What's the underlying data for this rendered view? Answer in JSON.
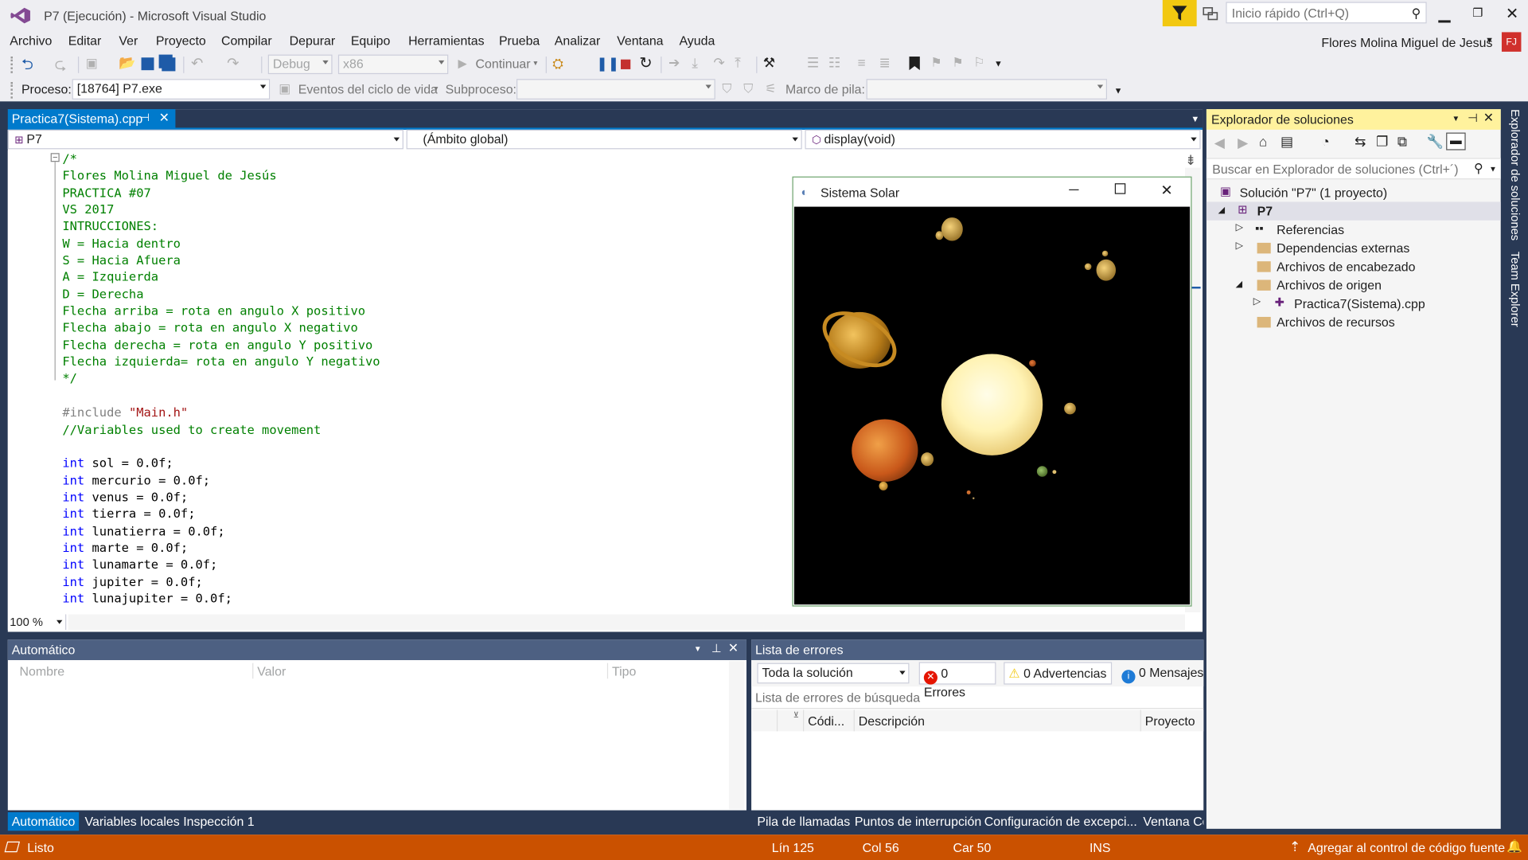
{
  "app": {
    "title": "P7 (Ejecución) - Microsoft Visual Studio",
    "quick_launch_placeholder": "Inicio rápido (Ctrl+Q)",
    "user": "Flores Molina Miguel de Jesus",
    "user_initials": "FJ"
  },
  "menu": [
    "Archivo",
    "Editar",
    "Ver",
    "Proyecto",
    "Compilar",
    "Depurar",
    "Equipo",
    "Herramientas",
    "Prueba",
    "Analizar",
    "Ventana",
    "Ayuda"
  ],
  "toolbar": {
    "config": "Debug",
    "platform": "x86",
    "continue_label": "Continuar"
  },
  "debug_toolbar": {
    "process_label": "Proceso:",
    "process_value": "[18764] P7.exe",
    "lifecycle_label": "Eventos del ciclo de vida",
    "thread_label": "Subproceso:",
    "stack_label": "Marco de pila:"
  },
  "editor": {
    "tab_label": "Practica7(Sistema).cpp",
    "nav_project": "P7",
    "nav_scope": "(Ámbito global)",
    "nav_member": "display(void)",
    "zoom": "100 %",
    "lines": [
      {
        "t": "c",
        "v": "/*"
      },
      {
        "t": "c",
        "v": "Flores Molina Miguel de Jesús"
      },
      {
        "t": "c",
        "v": "PRACTICA #07"
      },
      {
        "t": "c",
        "v": "VS 2017"
      },
      {
        "t": "c",
        "v": "INTRUCCIONES:"
      },
      {
        "t": "c",
        "v": "W = Hacia dentro"
      },
      {
        "t": "c",
        "v": "S = Hacia Afuera"
      },
      {
        "t": "c",
        "v": "A = Izquierda"
      },
      {
        "t": "c",
        "v": "D = Derecha"
      },
      {
        "t": "c",
        "v": "Flecha arriba = rota en angulo X positivo"
      },
      {
        "t": "c",
        "v": "Flecha abajo = rota en angulo X negativo"
      },
      {
        "t": "c",
        "v": "Flecha derecha = rota en angulo Y positivo"
      },
      {
        "t": "c",
        "v": "Flecha izquierda= rota en angulo Y negativo"
      },
      {
        "t": "c",
        "v": "*/"
      },
      {
        "t": "n",
        "v": ""
      },
      {
        "t": "inc",
        "a": "#include ",
        "b": "\"Main.h\""
      },
      {
        "t": "c",
        "v": "//Variables used to create movement"
      },
      {
        "t": "n",
        "v": ""
      },
      {
        "t": "kw",
        "a": "int",
        "b": " sol = 0.0f;"
      },
      {
        "t": "kw",
        "a": "int",
        "b": " mercurio = 0.0f;"
      },
      {
        "t": "kw",
        "a": "int",
        "b": " venus = 0.0f;"
      },
      {
        "t": "kw",
        "a": "int",
        "b": " tierra = 0.0f;"
      },
      {
        "t": "kw",
        "a": "int",
        "b": " lunatierra = 0.0f;"
      },
      {
        "t": "kw",
        "a": "int",
        "b": " marte = 0.0f;"
      },
      {
        "t": "kw",
        "a": "int",
        "b": " lunamarte = 0.0f;"
      },
      {
        "t": "kw",
        "a": "int",
        "b": " jupiter = 0.0f;"
      },
      {
        "t": "kw",
        "a": "int",
        "b": " lunajupiter = 0.0f;"
      }
    ]
  },
  "solar_window": {
    "title": "Sistema Solar"
  },
  "autos": {
    "title": "Automático",
    "columns": [
      "Nombre",
      "Valor",
      "Tipo"
    ],
    "tabs": [
      "Automático",
      "Variables locales",
      "Inspección 1"
    ]
  },
  "errors": {
    "title": "Lista de errores",
    "scope": "Toda la solución",
    "errors_label": "0 Errores",
    "warnings_label": "0 Advertencias",
    "messages_label": "0 Mensajes",
    "search_placeholder": "Lista de errores de búsqueda",
    "columns": [
      "Códi...",
      "Descripción",
      "Proyecto"
    ],
    "tabs": [
      "Pila de llamadas",
      "Puntos de interrupción",
      "Configuración de excepci...",
      "Ventana Co"
    ]
  },
  "solution_explorer": {
    "title": "Explorador de soluciones",
    "search_placeholder": "Buscar en Explorador de soluciones (Ctrl+´)",
    "items": [
      {
        "label": "Solución \"P7\"  (1 proyecto)",
        "icon": "solution-icon"
      },
      {
        "label": "P7",
        "icon": "project-icon"
      },
      {
        "label": "Referencias",
        "icon": "references-icon"
      },
      {
        "label": "Dependencias externas",
        "icon": "folder-icon"
      },
      {
        "label": "Archivos de encabezado",
        "icon": "folder-icon"
      },
      {
        "label": "Archivos de origen",
        "icon": "folder-icon"
      },
      {
        "label": "Practica7(Sistema).cpp",
        "icon": "cpp-file-icon"
      },
      {
        "label": "Archivos de recursos",
        "icon": "folder-icon"
      }
    ]
  },
  "side_tabs": [
    "Explorador de soluciones",
    "Team Explorer"
  ],
  "status": {
    "state": "Listo",
    "line": "Lín 125",
    "col": "Col 56",
    "car": "Car 50",
    "mode": "INS",
    "source_control": "Agregar al control de código fuente"
  },
  "colors": {
    "accent": "#007ACC",
    "status_bar": "#CA5100",
    "dock": "#293955"
  }
}
